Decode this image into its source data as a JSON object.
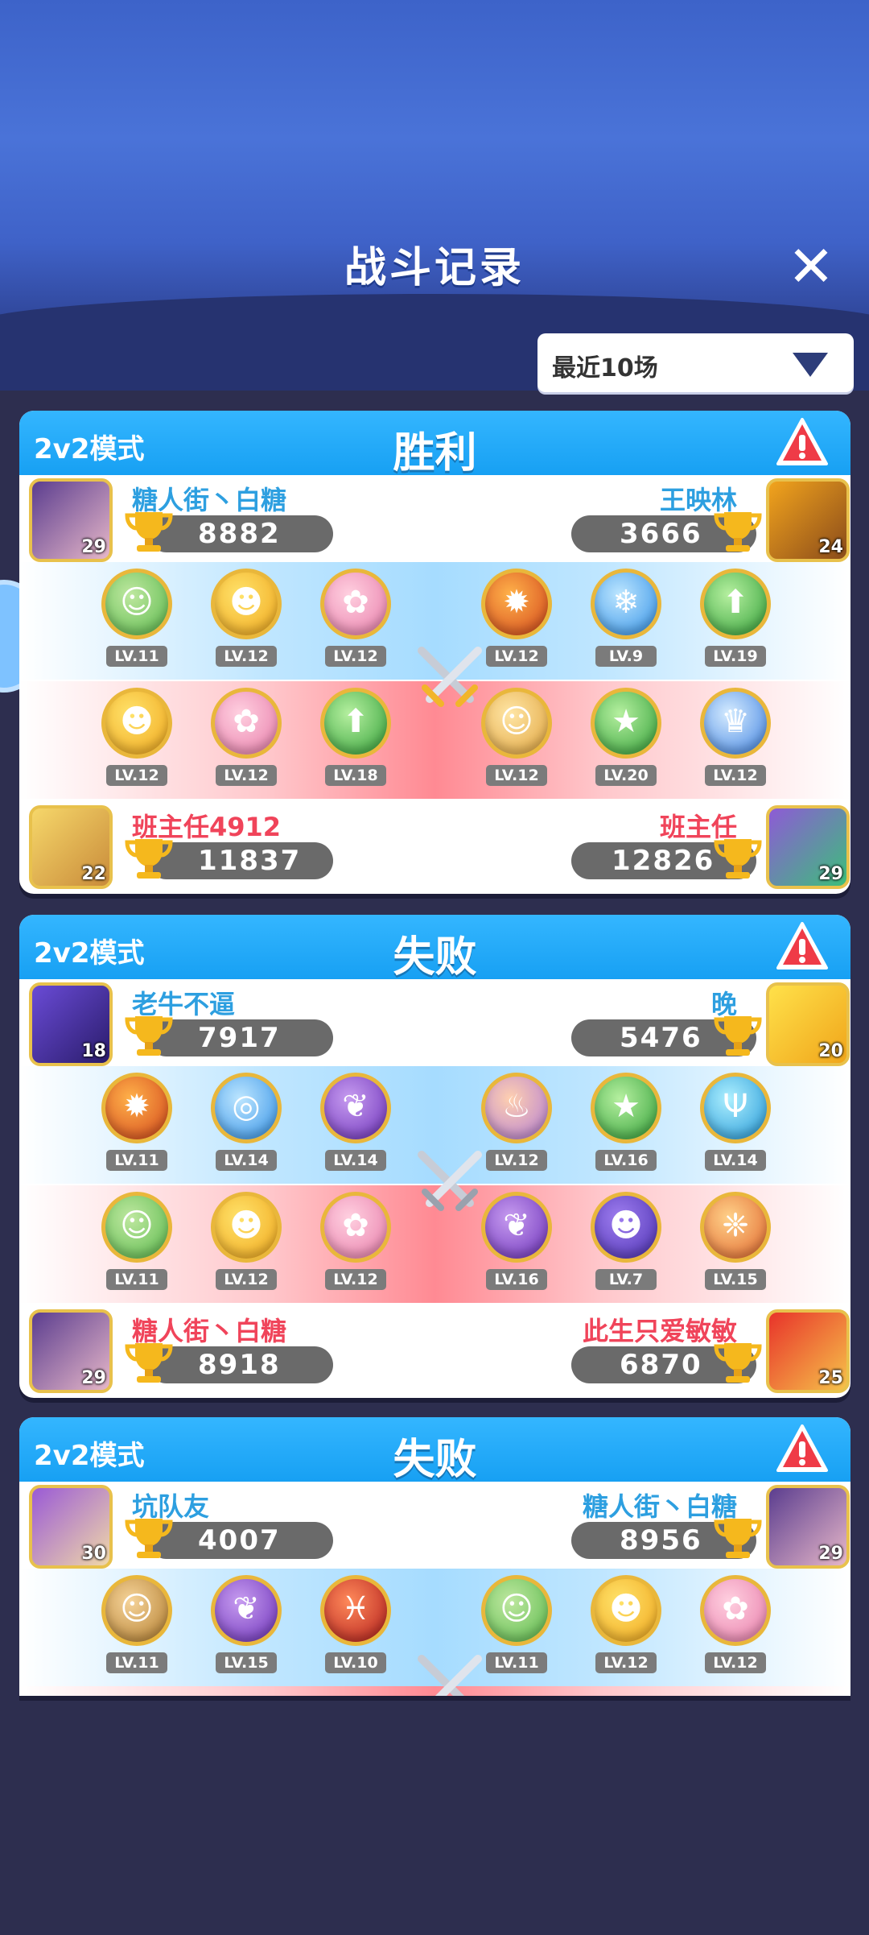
{
  "header": {
    "title": "战斗记录",
    "close_label": "✕"
  },
  "filter": {
    "label": "最近10场"
  },
  "colors": {
    "blue_name": "#2d9fe0",
    "red_name": "#f0445a",
    "header_blue": "#17a0f3"
  },
  "icons": {
    "close": "close-icon",
    "report": "warning-triangle-icon",
    "trophy": "trophy-icon",
    "vs": "crossed-swords-icon",
    "dropdown": "chevron-down-icon"
  },
  "matches": [
    {
      "mode": "2v2模式",
      "result": "胜利",
      "top_left": {
        "name": "糖人街丶白糖",
        "trophies": "8882",
        "level": "29"
      },
      "top_right": {
        "name": "王映林",
        "trophies": "3666",
        "level": "24"
      },
      "blue_pets": [
        "LV.11",
        "LV.12",
        "LV.12",
        "LV.12",
        "LV.9",
        "LV.19"
      ],
      "red_pets": [
        "LV.12",
        "LV.12",
        "LV.18",
        "LV.12",
        "LV.20",
        "LV.12"
      ],
      "bottom_left": {
        "name": "班主任4912",
        "trophies": "11837",
        "level": "22"
      },
      "bottom_right": {
        "name": "班主任",
        "trophies": "12826",
        "level": "29"
      }
    },
    {
      "mode": "2v2模式",
      "result": "失败",
      "top_left": {
        "name": "老牛不逼",
        "trophies": "7917",
        "level": "18"
      },
      "top_right": {
        "name": "晚",
        "trophies": "5476",
        "level": "20"
      },
      "blue_pets": [
        "LV.11",
        "LV.14",
        "LV.14",
        "LV.12",
        "LV.16",
        "LV.14"
      ],
      "red_pets": [
        "LV.11",
        "LV.12",
        "LV.12",
        "LV.16",
        "LV.7",
        "LV.15"
      ],
      "bottom_left": {
        "name": "糖人街丶白糖",
        "trophies": "8918",
        "level": "29"
      },
      "bottom_right": {
        "name": "此生只爱敏敏",
        "trophies": "6870",
        "level": "25"
      }
    },
    {
      "mode": "2v2模式",
      "result": "失败",
      "top_left": {
        "name": "坑队友",
        "trophies": "4007",
        "level": "30"
      },
      "top_right": {
        "name": "糖人街丶白糖",
        "trophies": "8956",
        "level": "29"
      },
      "blue_pets": [
        "LV.11",
        "LV.15",
        "LV.10",
        "LV.11",
        "LV.12",
        "LV.12"
      ]
    }
  ]
}
